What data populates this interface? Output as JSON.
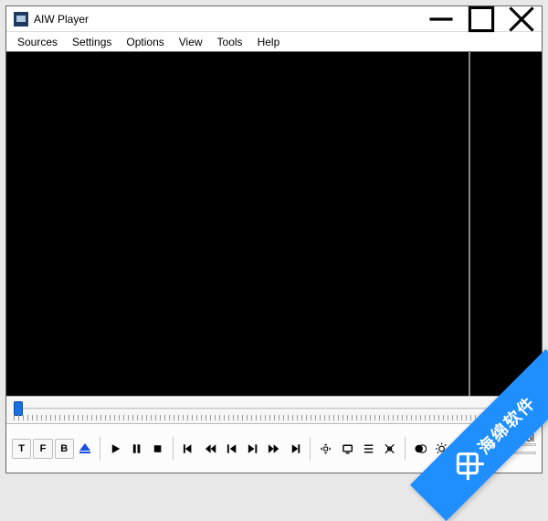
{
  "window": {
    "title": "AIW Player"
  },
  "menu": {
    "items": [
      "Sources",
      "Settings",
      "Options",
      "View",
      "Tools",
      "Help"
    ]
  },
  "toolbar": {
    "tv_btn": "T",
    "fm_btn": "F",
    "back_btn": "B"
  },
  "labels": {
    "volume": "Vol"
  },
  "watermark": {
    "text": "海绵软件"
  }
}
